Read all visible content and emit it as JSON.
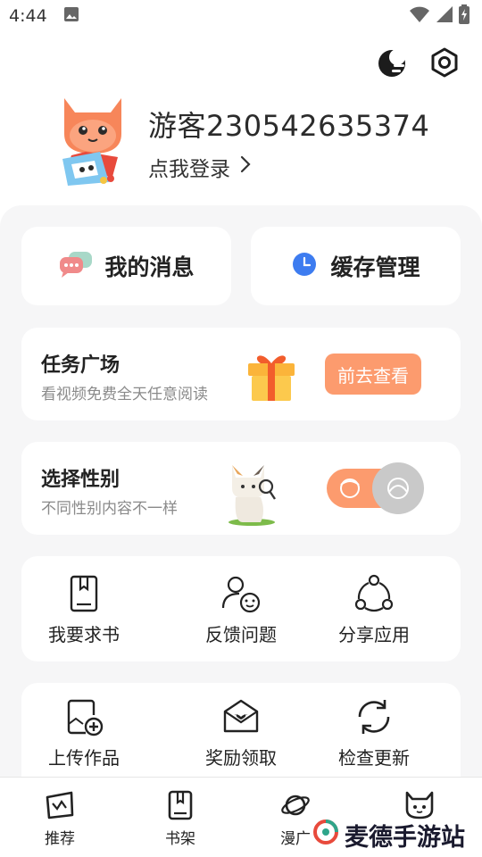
{
  "status_bar": {
    "time": "4:44"
  },
  "profile": {
    "username": "游客230542635374",
    "login_text": "点我登录"
  },
  "quick": {
    "messages_label": "我的消息",
    "cache_label": "缓存管理"
  },
  "task": {
    "title": "任务广场",
    "subtitle": "看视频免费全天任意阅读",
    "button_label": "前去查看"
  },
  "gender": {
    "title": "选择性别",
    "subtitle": "不同性别内容不一样"
  },
  "grid": {
    "items": [
      {
        "label": "我要求书",
        "icon": "book-request-icon"
      },
      {
        "label": "反馈问题",
        "icon": "feedback-icon"
      },
      {
        "label": "分享应用",
        "icon": "share-icon"
      },
      {
        "label": "上传作品",
        "icon": "upload-icon"
      },
      {
        "label": "奖励领取",
        "icon": "reward-icon"
      },
      {
        "label": "检查更新",
        "icon": "refresh-icon"
      }
    ]
  },
  "tabs": [
    {
      "label": "推荐",
      "icon": "recommend-icon"
    },
    {
      "label": "书架",
      "icon": "bookshelf-icon"
    },
    {
      "label": "漫广",
      "icon": "planet-icon"
    },
    {
      "label": "",
      "icon": "cat-profile-icon"
    }
  ],
  "watermark": {
    "text": "麦德手游站"
  },
  "colors": {
    "accent": "#fc9b6e",
    "panel_bg": "#f6f6f7",
    "blue": "#3d7cf0"
  }
}
